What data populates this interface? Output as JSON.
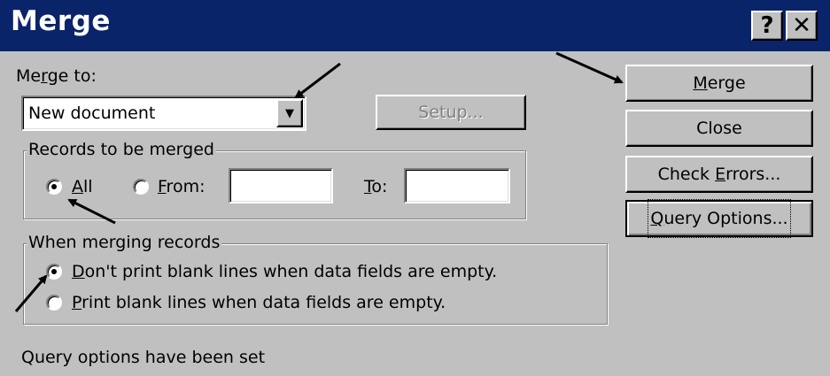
{
  "window": {
    "title": "Merge",
    "help_label": "?",
    "close_label": "✕"
  },
  "merge_to": {
    "label_pre": "Me",
    "label_key": "r",
    "label_post": "ge to:",
    "selected": "New document",
    "dropdown_arrow": "▼",
    "setup_label": "Setup..."
  },
  "records": {
    "legend": "Records to be merged",
    "all_key": "A",
    "all_rest": "ll",
    "from_key": "F",
    "from_rest": "rom:",
    "from_value": "",
    "to_key": "T",
    "to_rest": "o:",
    "to_value": "",
    "selected": "All"
  },
  "when_merging": {
    "legend": "When merging records",
    "opt1_key": "D",
    "opt1_rest": "on't print blank lines when data fields are empty.",
    "opt2_key": "P",
    "opt2_rest": "rint blank lines when data fields are empty.",
    "selected": "opt1"
  },
  "buttons": {
    "merge_key": "M",
    "merge_rest": "erge",
    "close_label": "Close",
    "check_pre": "Check ",
    "check_key": "E",
    "check_rest": "rrors...",
    "query_key": "Q",
    "query_rest": "uery Options..."
  },
  "status": "Query options have been set"
}
